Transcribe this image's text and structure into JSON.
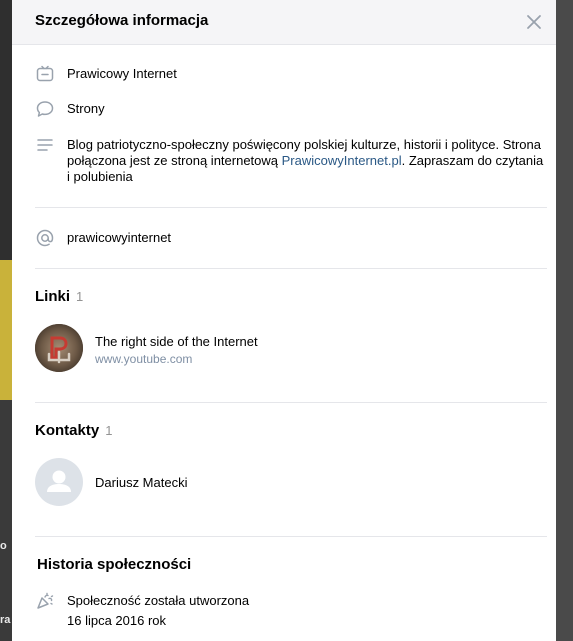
{
  "header": {
    "title": "Szczegółowa informacja"
  },
  "info": {
    "name": "Prawicowy Internet",
    "category": "Strony",
    "description_before": "Blog patriotyczno-społeczny poświęcony polskiej kulturze, historii i polityce. Strona połączona jest ze stroną internetową ",
    "description_link": "PrawicowyInternet.pl",
    "description_after": ". Zapraszam do czytania i polubienia",
    "handle": "prawicowyinternet"
  },
  "links": {
    "title": "Linki",
    "count": "1",
    "items": [
      {
        "title": "The right side of the Internet",
        "url": "www.youtube.com"
      }
    ]
  },
  "contacts": {
    "title": "Kontakty",
    "count": "1",
    "items": [
      {
        "name": "Dariusz Matecki"
      }
    ]
  },
  "history": {
    "title": "Historia społeczności",
    "event": "Społeczność została utworzona",
    "date": "16 lipca 2016 rok"
  },
  "backdrop": {
    "text1": "o",
    "text2": "ra"
  },
  "colors": {
    "accent": "#2a5885",
    "icon": "#99a2ad",
    "separator": "#e5e6ea"
  }
}
